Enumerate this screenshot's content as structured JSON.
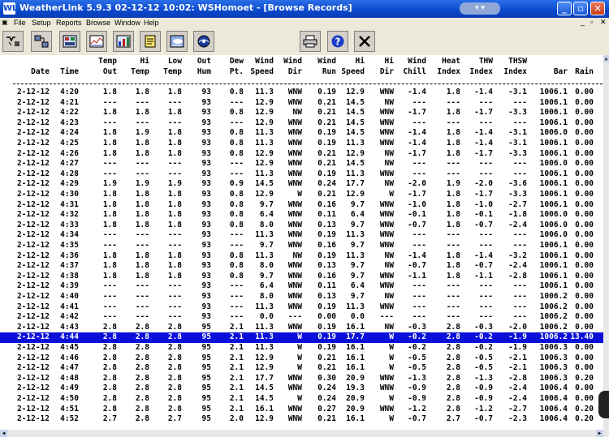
{
  "window": {
    "title": "WeatherLink 5.9.3  02-12-12  10:02: WSHomoet - [Browse Records]",
    "app_icon": "WL"
  },
  "menu": [
    "File",
    "Setup",
    "Reports",
    "Browse",
    "Window",
    "Help"
  ],
  "toolbar": {
    "left": [
      "connect-icon",
      "network-icon",
      "bulletin-icon",
      "strip-chart-icon",
      "notes-icon",
      "weather-icon",
      "noaa-icon"
    ],
    "right": [
      "print-icon",
      "help-icon",
      "close-icon"
    ],
    "help_glyph": "?",
    "close_glyph": "✕"
  },
  "columns": [
    {
      "l1": "",
      "l2": "Date"
    },
    {
      "l1": "",
      "l2": "Time"
    },
    {
      "l1": "Temp",
      "l2": "Out"
    },
    {
      "l1": "Hi",
      "l2": "Temp"
    },
    {
      "l1": "Low",
      "l2": "Temp"
    },
    {
      "l1": "Out",
      "l2": "Hum"
    },
    {
      "l1": "Dew",
      "l2": "Pt."
    },
    {
      "l1": "Wind",
      "l2": "Speed"
    },
    {
      "l1": "Wind",
      "l2": "Dir"
    },
    {
      "l1": "Wind",
      "l2": "Run"
    },
    {
      "l1": "Hi",
      "l2": "Speed"
    },
    {
      "l1": "Hi",
      "l2": "Dir"
    },
    {
      "l1": "Wind",
      "l2": "Chill"
    },
    {
      "l1": "Heat",
      "l2": "Index"
    },
    {
      "l1": "THW",
      "l2": "Index"
    },
    {
      "l1": "THSW",
      "l2": "Index"
    },
    {
      "l1": "",
      "l2": "Bar"
    },
    {
      "l1": "",
      "l2": "Rain"
    }
  ],
  "selected_row": 24,
  "rows": [
    [
      "2-12-12",
      "4:20",
      "1.8",
      "1.8",
      "1.8",
      "93",
      "0.8",
      "11.3",
      "WNW",
      "0.19",
      "12.9",
      "WNW",
      "-1.4",
      "1.8",
      "-1.4",
      "-3.1",
      "1006.1",
      "0.00"
    ],
    [
      "2-12-12",
      "4:21",
      "---",
      "---",
      "---",
      "93",
      "---",
      "12.9",
      "WNW",
      "0.21",
      "14.5",
      "NW",
      "---",
      "---",
      "---",
      "---",
      "1006.1",
      "0.00"
    ],
    [
      "2-12-12",
      "4:22",
      "1.8",
      "1.8",
      "1.8",
      "93",
      "0.8",
      "12.9",
      "NW",
      "0.21",
      "14.5",
      "WNW",
      "-1.7",
      "1.8",
      "-1.7",
      "-3.3",
      "1006.1",
      "0.00"
    ],
    [
      "2-12-12",
      "4:23",
      "---",
      "---",
      "---",
      "93",
      "---",
      "12.9",
      "WNW",
      "0.21",
      "14.5",
      "WNW",
      "---",
      "---",
      "---",
      "---",
      "1006.1",
      "0.00"
    ],
    [
      "2-12-12",
      "4:24",
      "1.8",
      "1.9",
      "1.8",
      "93",
      "0.8",
      "11.3",
      "WNW",
      "0.19",
      "14.5",
      "WNW",
      "-1.4",
      "1.8",
      "-1.4",
      "-3.1",
      "1006.0",
      "0.00"
    ],
    [
      "2-12-12",
      "4:25",
      "1.8",
      "1.8",
      "1.8",
      "93",
      "0.8",
      "11.3",
      "WNW",
      "0.19",
      "11.3",
      "WNW",
      "-1.4",
      "1.8",
      "-1.4",
      "-3.1",
      "1006.1",
      "0.00"
    ],
    [
      "2-12-12",
      "4:26",
      "1.8",
      "1.8",
      "1.8",
      "93",
      "0.8",
      "12.9",
      "WNW",
      "0.21",
      "12.9",
      "NW",
      "-1.7",
      "1.8",
      "-1.7",
      "-3.3",
      "1006.1",
      "0.00"
    ],
    [
      "2-12-12",
      "4:27",
      "---",
      "---",
      "---",
      "93",
      "---",
      "12.9",
      "WNW",
      "0.21",
      "14.5",
      "NW",
      "---",
      "---",
      "---",
      "---",
      "1006.0",
      "0.00"
    ],
    [
      "2-12-12",
      "4:28",
      "---",
      "---",
      "---",
      "93",
      "---",
      "11.3",
      "WNW",
      "0.19",
      "11.3",
      "WNW",
      "---",
      "---",
      "---",
      "---",
      "1006.1",
      "0.00"
    ],
    [
      "2-12-12",
      "4:29",
      "1.9",
      "1.9",
      "1.9",
      "93",
      "0.9",
      "14.5",
      "WNW",
      "0.24",
      "17.7",
      "NW",
      "-2.0",
      "1.9",
      "-2.0",
      "-3.6",
      "1006.1",
      "0.00"
    ],
    [
      "2-12-12",
      "4:30",
      "1.8",
      "1.8",
      "1.8",
      "93",
      "0.8",
      "12.9",
      "W",
      "0.21",
      "12.9",
      "W",
      "-1.7",
      "1.8",
      "-1.7",
      "-3.3",
      "1006.1",
      "0.00"
    ],
    [
      "2-12-12",
      "4:31",
      "1.8",
      "1.8",
      "1.8",
      "93",
      "0.8",
      "9.7",
      "WNW",
      "0.16",
      "9.7",
      "WNW",
      "-1.0",
      "1.8",
      "-1.0",
      "-2.7",
      "1006.1",
      "0.00"
    ],
    [
      "2-12-12",
      "4:32",
      "1.8",
      "1.8",
      "1.8",
      "93",
      "0.8",
      "6.4",
      "WNW",
      "0.11",
      "6.4",
      "WNW",
      "-0.1",
      "1.8",
      "-0.1",
      "-1.8",
      "1006.0",
      "0.00"
    ],
    [
      "2-12-12",
      "4:33",
      "1.8",
      "1.8",
      "1.8",
      "93",
      "0.8",
      "8.0",
      "WNW",
      "0.13",
      "9.7",
      "WNW",
      "-0.7",
      "1.8",
      "-0.7",
      "-2.4",
      "1006.0",
      "0.00"
    ],
    [
      "2-12-12",
      "4:34",
      "---",
      "---",
      "---",
      "93",
      "---",
      "11.3",
      "WNW",
      "0.19",
      "11.3",
      "WNW",
      "---",
      "---",
      "---",
      "---",
      "1006.0",
      "0.00"
    ],
    [
      "2-12-12",
      "4:35",
      "---",
      "---",
      "---",
      "93",
      "---",
      "9.7",
      "WNW",
      "0.16",
      "9.7",
      "WNW",
      "---",
      "---",
      "---",
      "---",
      "1006.1",
      "0.00"
    ],
    [
      "2-12-12",
      "4:36",
      "1.8",
      "1.8",
      "1.8",
      "93",
      "0.8",
      "11.3",
      "NW",
      "0.19",
      "11.3",
      "NW",
      "-1.4",
      "1.8",
      "-1.4",
      "-3.2",
      "1006.1",
      "0.00"
    ],
    [
      "2-12-12",
      "4:37",
      "1.8",
      "1.8",
      "1.8",
      "93",
      "0.8",
      "8.0",
      "WNW",
      "0.13",
      "9.7",
      "NW",
      "-0.7",
      "1.8",
      "-0.7",
      "-2.4",
      "1006.1",
      "0.00"
    ],
    [
      "2-12-12",
      "4:38",
      "1.8",
      "1.8",
      "1.8",
      "93",
      "0.8",
      "9.7",
      "WNW",
      "0.16",
      "9.7",
      "WNW",
      "-1.1",
      "1.8",
      "-1.1",
      "-2.8",
      "1006.1",
      "0.00"
    ],
    [
      "2-12-12",
      "4:39",
      "---",
      "---",
      "---",
      "93",
      "---",
      "6.4",
      "WNW",
      "0.11",
      "6.4",
      "WNW",
      "---",
      "---",
      "---",
      "---",
      "1006.1",
      "0.00"
    ],
    [
      "2-12-12",
      "4:40",
      "---",
      "---",
      "---",
      "93",
      "---",
      "8.0",
      "WNW",
      "0.13",
      "9.7",
      "NW",
      "---",
      "---",
      "---",
      "---",
      "1006.2",
      "0.00"
    ],
    [
      "2-12-12",
      "4:41",
      "---",
      "---",
      "---",
      "93",
      "---",
      "11.3",
      "WNW",
      "0.19",
      "11.3",
      "WNW",
      "---",
      "---",
      "---",
      "---",
      "1006.2",
      "0.00"
    ],
    [
      "2-12-12",
      "4:42",
      "---",
      "---",
      "---",
      "93",
      "---",
      "0.0",
      "---",
      "0.00",
      "0.0",
      "---",
      "---",
      "---",
      "---",
      "---",
      "1006.2",
      "0.00"
    ],
    [
      "2-12-12",
      "4:43",
      "2.8",
      "2.8",
      "2.8",
      "95",
      "2.1",
      "11.3",
      "WNW",
      "0.19",
      "16.1",
      "NW",
      "-0.3",
      "2.8",
      "-0.3",
      "-2.0",
      "1006.2",
      "0.00"
    ],
    [
      "2-12-12",
      "4:44",
      "2.8",
      "2.8",
      "2.8",
      "95",
      "2.1",
      "11.3",
      "W",
      "0.19",
      "17.7",
      "W",
      "-0.2",
      "2.8",
      "-0.2",
      "-1.9",
      "1006.2",
      "13.40"
    ],
    [
      "2-12-12",
      "4:45",
      "2.8",
      "2.8",
      "2.8",
      "95",
      "2.1",
      "11.3",
      "W",
      "0.19",
      "16.1",
      "W",
      "-0.2",
      "2.8",
      "-0.2",
      "-1.9",
      "1006.3",
      "0.00"
    ],
    [
      "2-12-12",
      "4:46",
      "2.8",
      "2.8",
      "2.8",
      "95",
      "2.1",
      "12.9",
      "W",
      "0.21",
      "16.1",
      "W",
      "-0.5",
      "2.8",
      "-0.5",
      "-2.1",
      "1006.3",
      "0.00"
    ],
    [
      "2-12-12",
      "4:47",
      "2.8",
      "2.8",
      "2.8",
      "95",
      "2.1",
      "12.9",
      "W",
      "0.21",
      "16.1",
      "W",
      "-0.5",
      "2.8",
      "-0.5",
      "-2.1",
      "1006.3",
      "0.00"
    ],
    [
      "2-12-12",
      "4:48",
      "2.8",
      "2.8",
      "2.8",
      "95",
      "2.1",
      "17.7",
      "WNW",
      "0.30",
      "20.9",
      "WNW",
      "-1.3",
      "2.8",
      "-1.3",
      "-2.8",
      "1006.3",
      "0.20"
    ],
    [
      "2-12-12",
      "4:49",
      "2.8",
      "2.8",
      "2.8",
      "95",
      "2.1",
      "14.5",
      "WNW",
      "0.24",
      "19.3",
      "WNW",
      "-0.9",
      "2.8",
      "-0.9",
      "-2.4",
      "1006.4",
      "0.00"
    ],
    [
      "2-12-12",
      "4:50",
      "2.8",
      "2.8",
      "2.8",
      "95",
      "2.1",
      "14.5",
      "W",
      "0.24",
      "20.9",
      "W",
      "-0.9",
      "2.8",
      "-0.9",
      "-2.4",
      "1006.4",
      "0.00"
    ],
    [
      "2-12-12",
      "4:51",
      "2.8",
      "2.8",
      "2.8",
      "95",
      "2.1",
      "16.1",
      "WNW",
      "0.27",
      "20.9",
      "WNW",
      "-1.2",
      "2.8",
      "-1.2",
      "-2.7",
      "1006.4",
      "0.20"
    ],
    [
      "2-12-12",
      "4:52",
      "2.7",
      "2.8",
      "2.7",
      "95",
      "2.0",
      "12.9",
      "WNW",
      "0.21",
      "16.1",
      "W",
      "-0.7",
      "2.7",
      "-0.7",
      "-2.3",
      "1006.4",
      "0.20"
    ]
  ],
  "colors": {
    "title_bar": "#0a48cc",
    "selection": "#0a10d8",
    "chrome": "#ece9d8"
  }
}
